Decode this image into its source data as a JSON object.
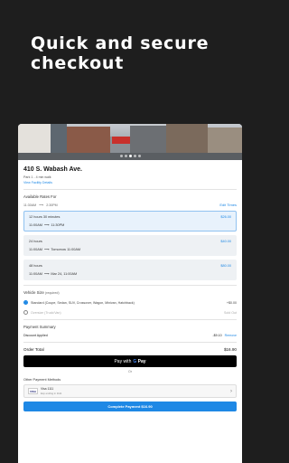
{
  "promo": {
    "line1": "Quick and secure",
    "line2": "checkout"
  },
  "hero": {
    "carousel_total": 5,
    "carousel_active": 3
  },
  "facility": {
    "name": "410 S. Wabash Ave.",
    "walk": "Park 1 - 4 min walk",
    "details_link": "View Facility Details"
  },
  "rates": {
    "label": "Available Rates For",
    "time_from": "11:30AM",
    "time_to": "2:30PM",
    "edit_link": "Edit Times",
    "options": [
      {
        "duration": "12 hours 30 minutes",
        "price": "$26.00",
        "start": "11:00AM",
        "end": "11:30PM",
        "selected": true
      },
      {
        "duration": "24 hours",
        "price": "$40.00",
        "start": "11:00AM",
        "end": "Tomorrow 11:00AM",
        "selected": false
      },
      {
        "duration": "48 hours",
        "price": "$80.00",
        "start": "11:00AM",
        "end": "Mar 24, 11:00AM",
        "selected": false
      }
    ]
  },
  "vehicle": {
    "label": "Vehicle Size",
    "required": "(required)",
    "standard_label": "Standard (Coupe, Sedan, SUV, Crossover, Wagon, Minivan, Hatchback)",
    "standard_price": "+$0.00",
    "oversize_label": "Oversize (Truck/Van)",
    "oversize_status": "Sold Out"
  },
  "summary": {
    "label": "Payment Summary",
    "discount_label": "Discount Applied",
    "discount_value": "-$9.10",
    "remove_label": "Remove",
    "total_label": "Order Total",
    "total_value": "$16.90"
  },
  "gpay": {
    "prefix": "Pay with",
    "g": "G",
    "brand": "Pay"
  },
  "or_label": "Or",
  "other": {
    "label": "Other Payment Methods",
    "card_brand": "VISA",
    "card_name": "Visa 1111",
    "card_sub": "Exp ending in 1111"
  },
  "complete_label": "Complete Payment $16.90",
  "colors": {
    "accent": "#1e88e5",
    "background": "#1e1e1e"
  }
}
